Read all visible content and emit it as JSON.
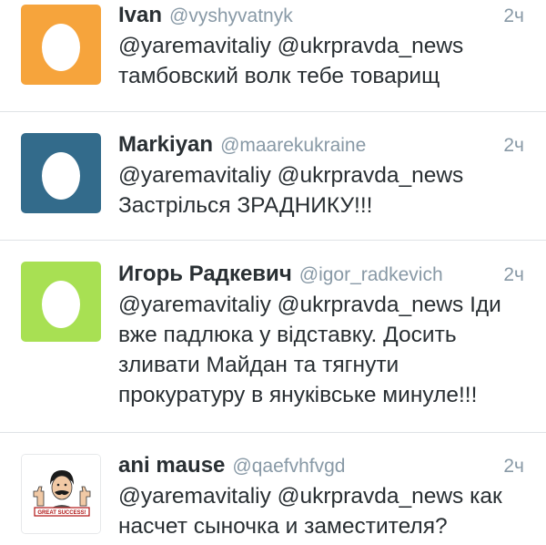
{
  "tweets": [
    {
      "name": "Ivan",
      "handle": "@vyshyvatnyk",
      "time": "2ч",
      "text": "@yaremavitaliy @ukrpravda_news тамбовский волк тебе товарищ",
      "avatar_color": "#f6a43c",
      "avatar_icon": "default-egg-icon"
    },
    {
      "name": "Markiyan",
      "handle": "@maarekukraine",
      "time": "2ч",
      "text": "@yaremavitaliy @ukrpravda_news Застрілься ЗРАДНИКУ!!!",
      "avatar_color": "#336b8b",
      "avatar_icon": "default-egg-icon"
    },
    {
      "name": "Игорь Радкевич",
      "handle": "@igor_radkevich",
      "time": "2ч",
      "text": "@yaremavitaliy @ukrpravda_news Іди вже падлюка у відставку. Досить зливати Майдан та тягнути прокуратуру в януківське минуле!!!",
      "avatar_color": "#a8e053",
      "avatar_icon": "default-egg-icon"
    },
    {
      "name": "ani mause",
      "handle": "@qaefvhfvgd",
      "time": "2ч",
      "text": "@yaremavitaliy @ukrpravda_news как насчет сыночка и заместителя?",
      "avatar_color": "#ffffff",
      "avatar_icon": "cartoon-man-thumbs-up-icon",
      "avatar_caption": "GREAT SUCCESS!"
    }
  ]
}
